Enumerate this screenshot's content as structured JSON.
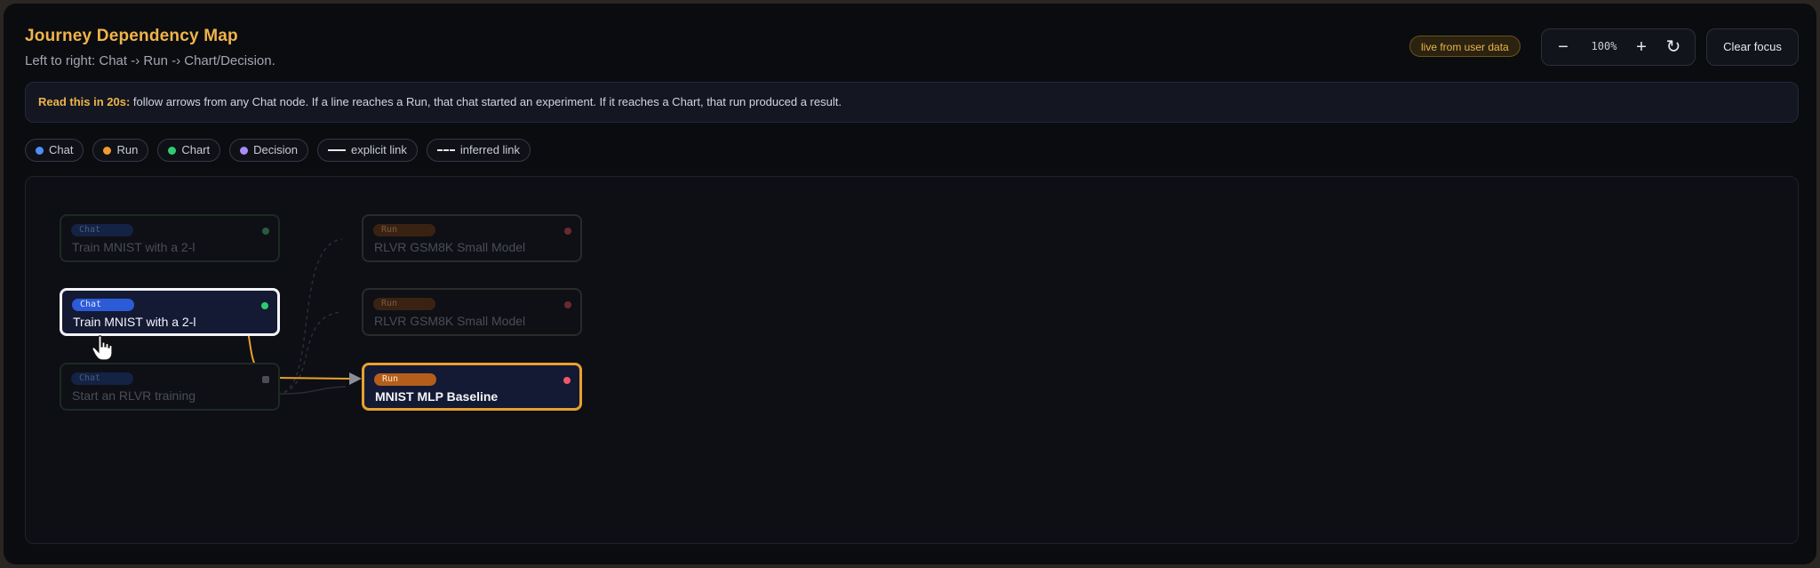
{
  "header": {
    "title": "Journey Dependency Map",
    "subtitle": "Left to right: Chat -› Run -› Chart/Decision.",
    "live_badge": "live from user data",
    "zoom_level": "100%",
    "zoom_out_label": "−",
    "zoom_in_label": "+",
    "reset_label": "↻",
    "clear_focus_label": "Clear focus"
  },
  "hint": {
    "lead": "Read this in 20s:",
    "text": " follow arrows from any Chat node. If a line reaches a Run, that chat started an experiment. If it reaches a Chart, that run produced a result."
  },
  "legend": {
    "chat": "Chat",
    "run": "Run",
    "chart": "Chart",
    "decision": "Decision",
    "explicit": "explicit link",
    "inferred": "inferred link"
  },
  "colors": {
    "chat": "#4f8ef7",
    "run": "#f29a2e",
    "chart": "#2ecc71",
    "decision": "#a78bfa",
    "edge_active": "#e8a12e"
  },
  "nodes": {
    "chat1": {
      "type": "Chat",
      "label": "Train MNIST with a 2-l"
    },
    "chat2": {
      "type": "Chat",
      "label": "Train MNIST with a 2-l"
    },
    "chat3": {
      "type": "Chat",
      "label": "Start an RLVR training"
    },
    "run1": {
      "type": "Run",
      "label": "RLVR GSM8K Small Model"
    },
    "run2": {
      "type": "Run",
      "label": "RLVR GSM8K Small Model"
    },
    "run3": {
      "type": "Run",
      "label": "MNIST MLP Baseline"
    }
  }
}
